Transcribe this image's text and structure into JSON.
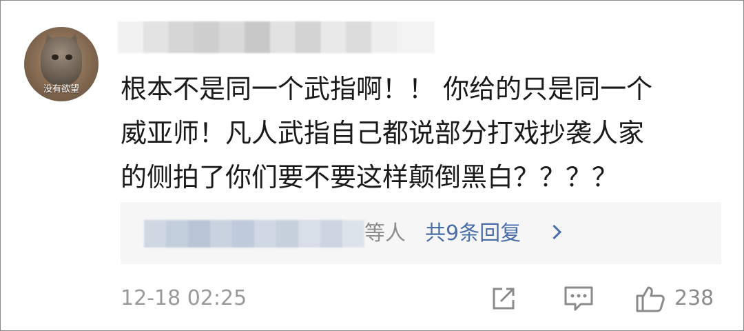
{
  "avatar": {
    "caption": "没有欲望"
  },
  "comment": {
    "lines": [
      "根本不是同一个武指啊！！ 你给的只是同一个",
      "威亚师！凡人武指自己都说部分打戏抄袭人家",
      "的侧拍了你们要不要这样颠倒黑白？？？？"
    ]
  },
  "replies": {
    "others_label": "等人",
    "count_label": "共9条回复"
  },
  "meta": {
    "timestamp": "12-18 02:25",
    "like_count": "238"
  },
  "icons": {
    "share": "share-icon",
    "comment": "comment-icon",
    "like": "thumbs-up-icon",
    "chevron": "chevron-right-icon"
  },
  "colors": {
    "link": "#4a6ea8",
    "muted": "#9a9a9a",
    "text": "#1a1a1a"
  }
}
